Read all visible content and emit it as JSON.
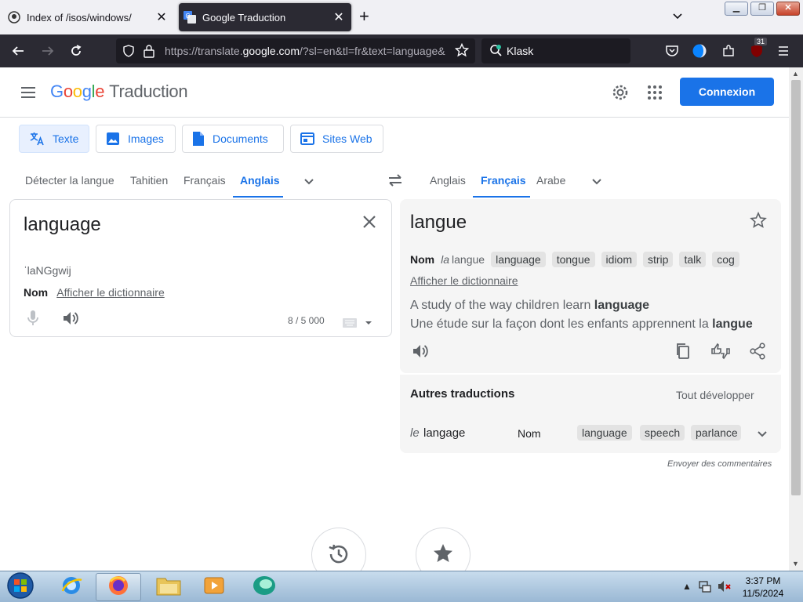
{
  "browser": {
    "tabs": [
      {
        "title": "Index of /isos/windows/",
        "active": false
      },
      {
        "title": "Google Traduction",
        "active": true
      }
    ],
    "url_prefix": "https://translate.",
    "url_domain": "google.com",
    "url_suffix": "/?sl=en&tl=fr&text=language&op=translate",
    "search_text": "Klask",
    "ext_badge": "31"
  },
  "header": {
    "logo_parts": [
      "G",
      "o",
      "o",
      "g",
      "l",
      "e"
    ],
    "product": "Traduction",
    "signin_label": "Connexion"
  },
  "modes": [
    {
      "label": "Texte",
      "icon": "translate-icon"
    },
    {
      "label": "Images",
      "icon": "image-icon"
    },
    {
      "label": "Documents",
      "icon": "document-icon"
    },
    {
      "label": "Sites Web",
      "icon": "website-icon"
    }
  ],
  "source_langs": [
    "Détecter la langue",
    "Tahitien",
    "Français",
    "Anglais"
  ],
  "target_langs": [
    "Anglais",
    "Français",
    "Arabe"
  ],
  "source": {
    "text": "language",
    "transliteration": "ˈlaNGgwij",
    "pos": "Nom",
    "dict_link": "Afficher le dictionnaire",
    "counter": "8 / 5 000"
  },
  "target": {
    "text": "langue",
    "pos": "Nom",
    "article": "la",
    "lemma": "langue",
    "synonyms": [
      "language",
      "tongue",
      "idiom",
      "strip",
      "talk",
      "cog"
    ],
    "dict_link": "Afficher le dictionnaire",
    "example_en_pre": "A study of the way children learn ",
    "example_en_bold": "language",
    "example_fr_pre": "Une étude sur la façon dont les enfants apprennent la ",
    "example_fr_bold": "langue"
  },
  "others": {
    "title": "Autres traductions",
    "expand_label": "Tout développer",
    "row": {
      "article": "le",
      "word": "langage",
      "pos": "Nom",
      "synonyms": [
        "language",
        "speech",
        "parlance"
      ]
    }
  },
  "feedback": "Envoyer des commentaires",
  "taskbar": {
    "time": "3:37 PM",
    "date": "11/5/2024"
  },
  "colors": {
    "accent": "#1a73e8",
    "panel": "#f5f5f5"
  }
}
